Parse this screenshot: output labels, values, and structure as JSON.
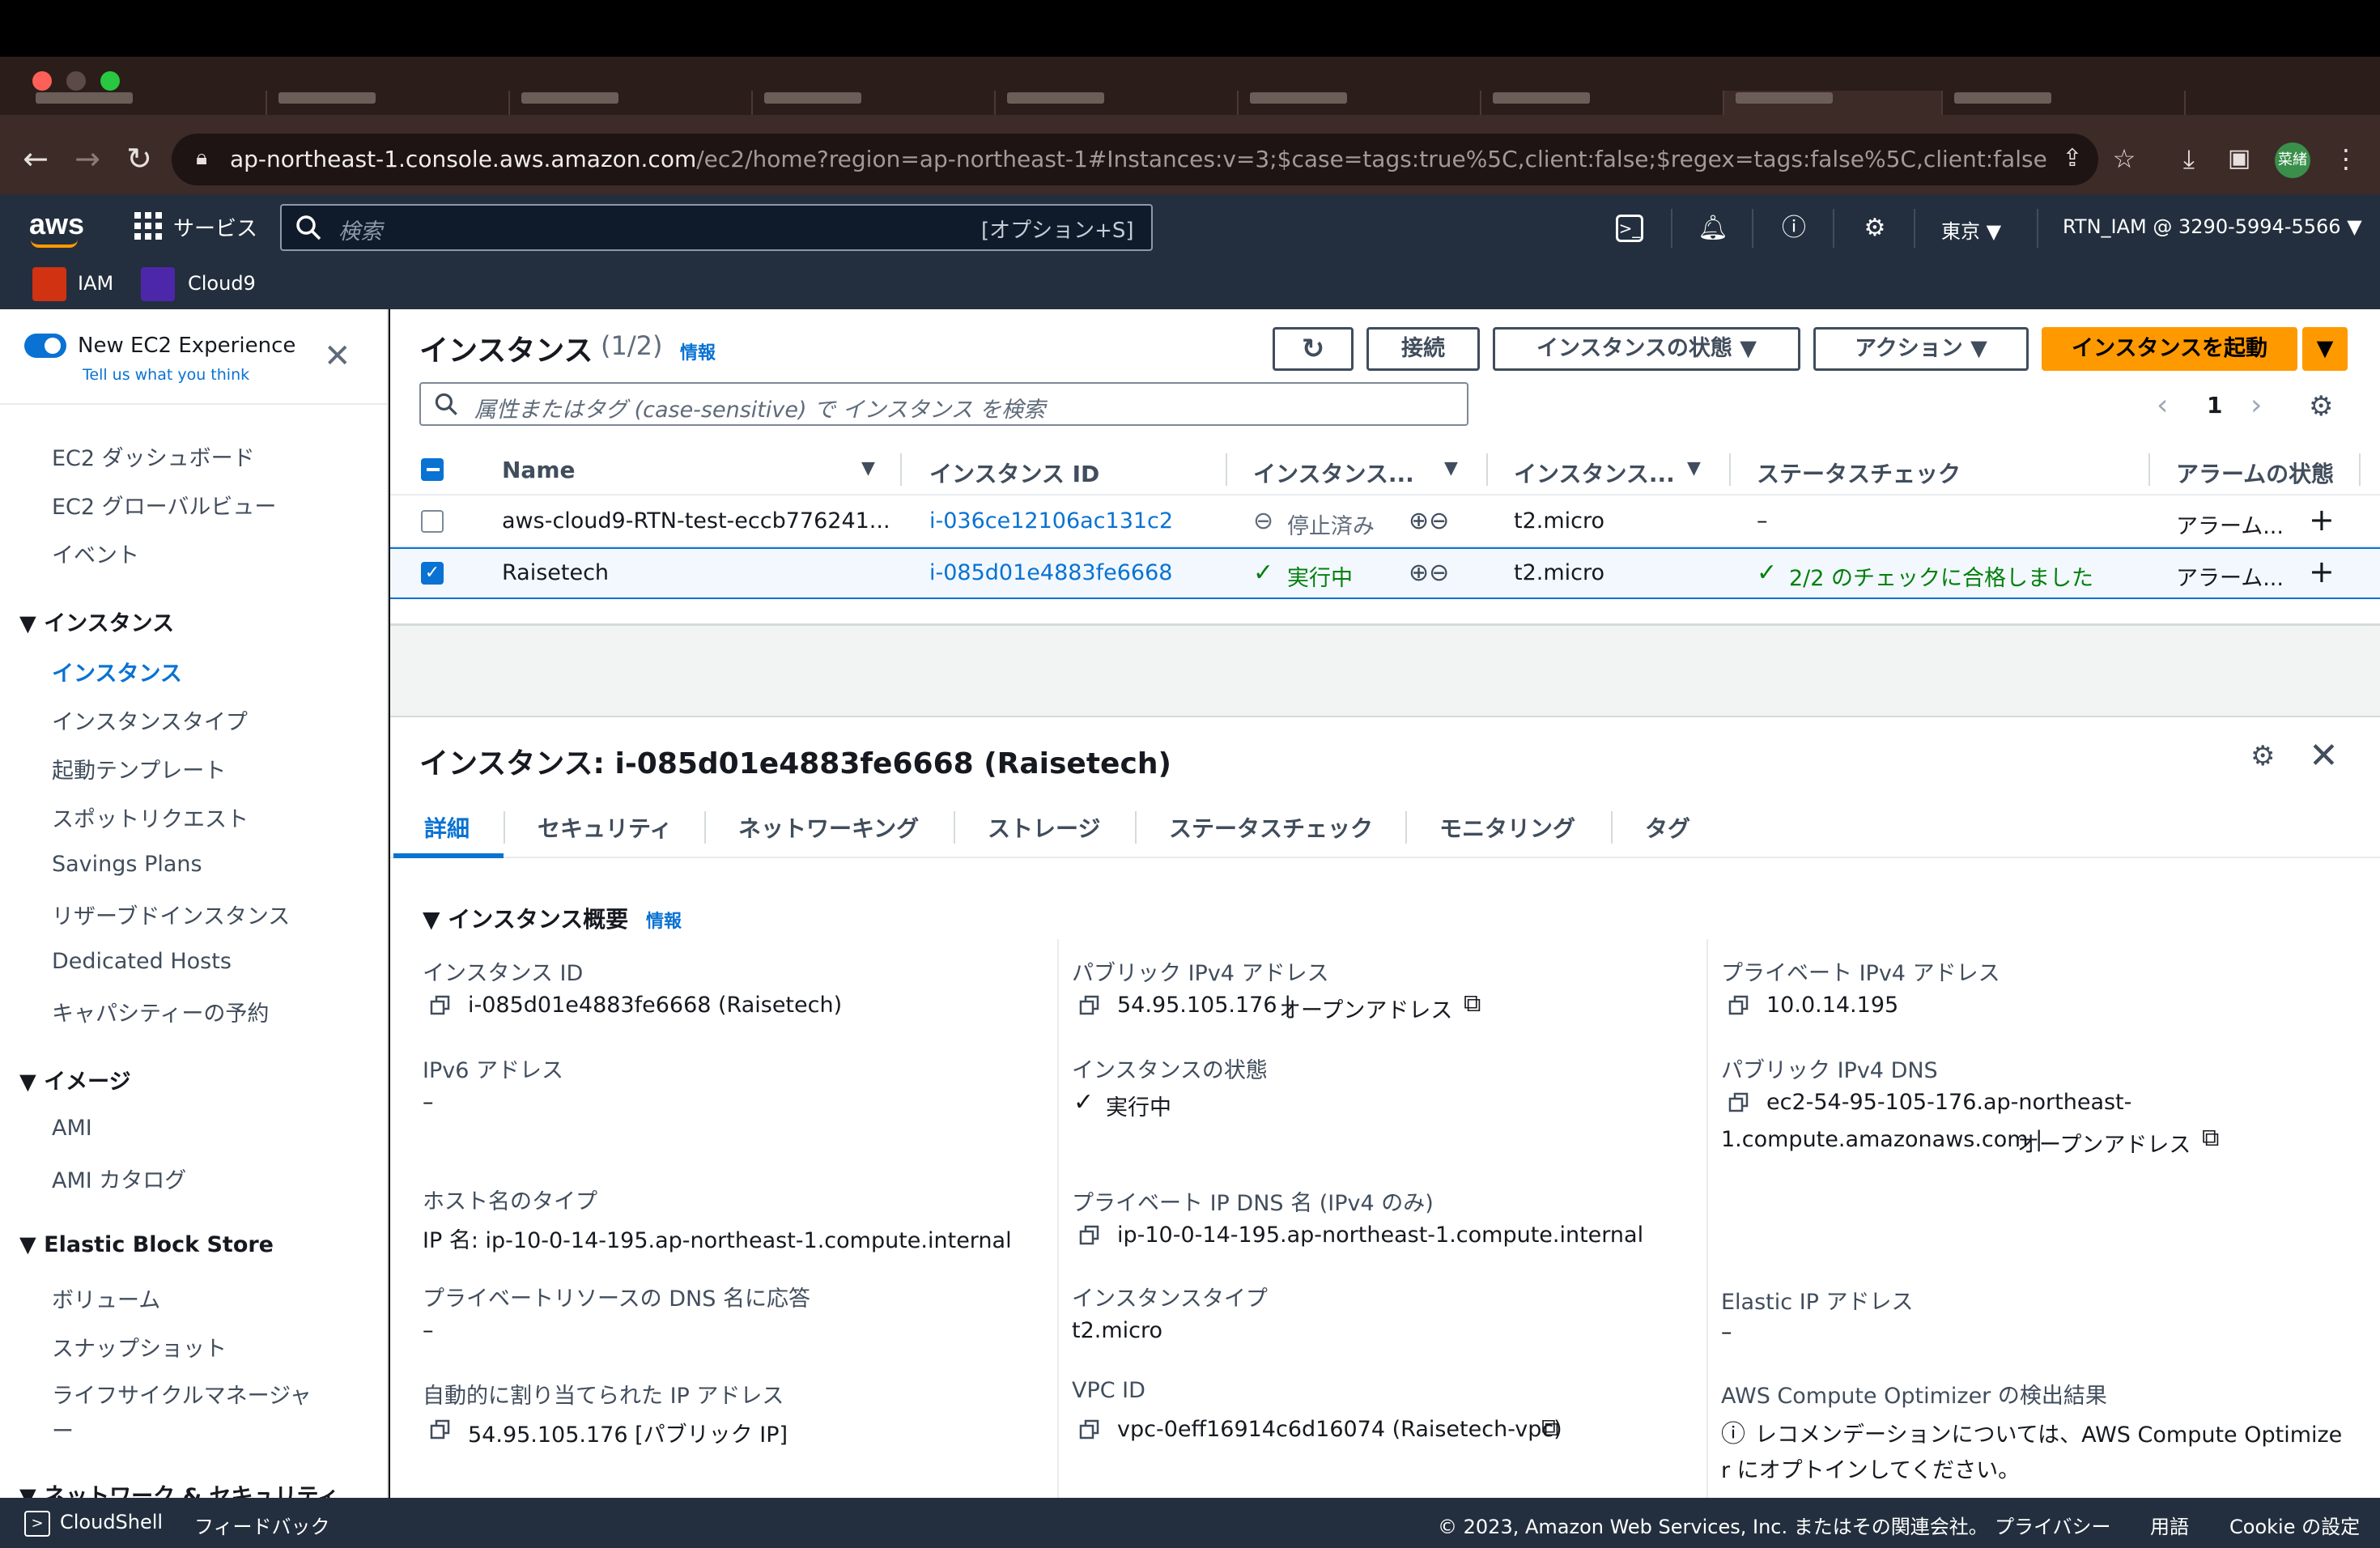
{
  "browser": {
    "url_host": "ap-northeast-1.console.aws.amazon.com",
    "url_path": "/ec2/home?region=ap-northeast-1#Instances:v=3;$case=tags:true%5C,client:false;$regex=tags:false%5C,client:false",
    "profile_initial": "菜緒"
  },
  "aws_nav": {
    "logo": "aws",
    "services_label": "サービス",
    "search_placeholder": "検索",
    "search_shortcut": "[オプション+S]",
    "region": "東京 ▼",
    "account": "RTN_IAM @ 3290-5994-5566 ▼",
    "favorites": [
      {
        "label": "IAM",
        "icon": "iam-icon",
        "color": "#d13212"
      },
      {
        "label": "Cloud9",
        "icon": "cloud9-icon",
        "color": "#4d27aa"
      }
    ]
  },
  "sidebar": {
    "new_experience": "New EC2 Experience",
    "tell_us": "Tell us what you think",
    "items_top": [
      "EC2 ダッシュボード",
      "EC2 グローバルビュー",
      "イベント"
    ],
    "section_instances": "▼  インスタンス",
    "instances_items": [
      "インスタンス",
      "インスタンスタイプ",
      "起動テンプレート",
      "スポットリクエスト",
      "Savings Plans",
      "リザーブドインスタンス",
      "Dedicated Hosts",
      "キャパシティーの予約"
    ],
    "section_images": "▼  イメージ",
    "images_items": [
      "AMI",
      "AMI カタログ"
    ],
    "section_ebs": "▼  Elastic Block Store",
    "ebs_items": [
      "ボリューム",
      "スナップショット",
      "ライフサイクルマネージャ",
      "ー"
    ],
    "section_network": "▼  ネットワーク & セキュリティ"
  },
  "list": {
    "title": "インスタンス",
    "count": "(1/2)",
    "info": "情報",
    "buttons": {
      "refresh": "↻",
      "connect": "接続",
      "state": "インスタンスの状態 ▼",
      "actions": "アクション ▼",
      "launch": "インスタンスを起動",
      "launch_dropdown": "▼"
    },
    "filter_placeholder": "属性またはタグ (case-sensitive) で インスタンス を検索",
    "page": "1",
    "columns": [
      "Name",
      "インスタンス ID",
      "インスタンス...",
      "インスタンス...",
      "ステータスチェック",
      "アラームの状態"
    ],
    "rows": [
      {
        "name": "aws-cloud9-RTN-test-eccb776241...",
        "id": "i-036ce12106ac131c2",
        "state": "停止済み",
        "type": "t2.micro",
        "status": "–",
        "alarm": "アラーム...",
        "selected": false
      },
      {
        "name": "Raisetech",
        "id": "i-085d01e4883fe6668",
        "state": "実行中",
        "type": "t2.micro",
        "status": "2/2 のチェックに合格しました",
        "alarm": "アラーム...",
        "selected": true
      }
    ]
  },
  "details": {
    "title": "インスタンス: i-085d01e4883fe6668 (Raisetech)",
    "tabs": [
      "詳細",
      "セキュリティ",
      "ネットワーキング",
      "ストレージ",
      "ステータスチェック",
      "モニタリング",
      "タグ"
    ],
    "section": "▼  インスタンス概要",
    "section_info": "情報",
    "fields": {
      "instance_id_label": "インスタンス ID",
      "instance_id": "i-085d01e4883fe6668 (Raisetech)",
      "public_ipv4_label": "パブリック IPv4 アドレス",
      "public_ipv4": "54.95.105.176 |",
      "open_address": "オープンアドレス",
      "private_ipv4_label": "プライベート IPv4 アドレス",
      "private_ipv4": "10.0.14.195",
      "ipv6_label": "IPv6 アドレス",
      "ipv6": "–",
      "state_label": "インスタンスの状態",
      "state": "実行中",
      "public_dns_label": "パブリック IPv4 DNS",
      "public_dns_1": "ec2-54-95-105-176.ap-northeast-",
      "public_dns_2": "1.compute.amazonaws.com |",
      "hostname_type_label": "ホスト名のタイプ",
      "hostname_type": "IP 名: ip-10-0-14-195.ap-northeast-1.compute.internal",
      "private_dns_label": "プライベート IP DNS 名 (IPv4 のみ)",
      "private_dns": "ip-10-0-14-195.ap-northeast-1.compute.internal",
      "answer_dns_label": "プライベートリソースの DNS 名に応答",
      "answer_dns": "–",
      "instance_type_label": "インスタンスタイプ",
      "instance_type": "t2.micro",
      "elastic_ip_label": "Elastic IP アドレス",
      "elastic_ip": "–",
      "auto_ip_label": "自動的に割り当てられた IP アドレス",
      "auto_ip": "54.95.105.176 [パブリック IP]",
      "vpc_label": "VPC ID",
      "vpc": "vpc-0eff16914c6d16074 (Raisetech-vpc)",
      "optimizer_label": "AWS Compute Optimizer の検出結果",
      "optimizer_1": "レコメンデーションについては、AWS Compute Optimize",
      "optimizer_2": "r にオプトインしてください。"
    }
  },
  "footer": {
    "cloudshell": "CloudShell",
    "feedback": "フィードバック",
    "copyright": "© 2023, Amazon Web Services, Inc. またはその関連会社。",
    "privacy": "プライバシー",
    "terms": "用語",
    "cookie": "Cookie の設定"
  },
  "colors": {
    "accent": "#0972d3",
    "launch": "#ff9900",
    "nav_bg": "#232f3e",
    "success": "#037f0c"
  }
}
